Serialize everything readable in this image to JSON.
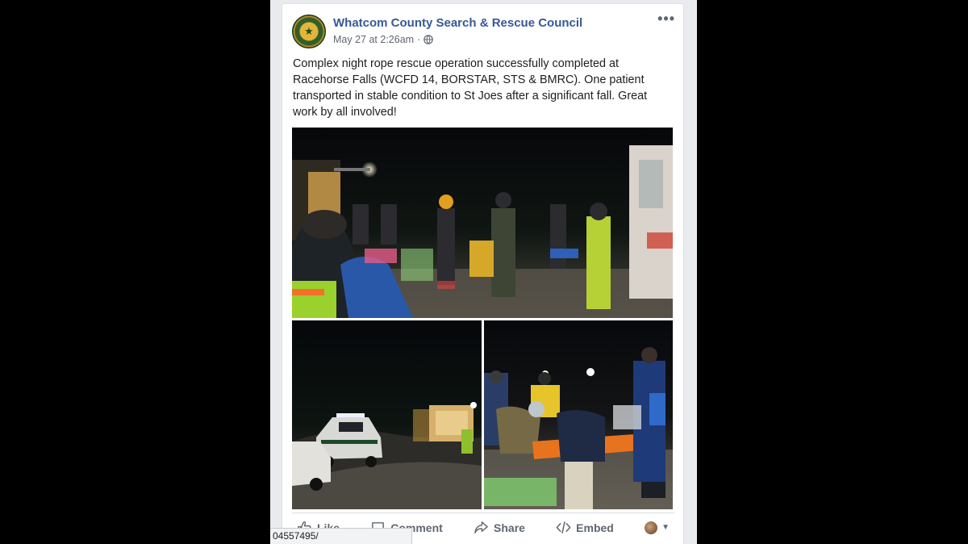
{
  "post": {
    "page_name": "Whatcom County Search & Rescue Council",
    "timestamp": "May 27 at 2:26am",
    "separator": "·",
    "privacy_icon": "globe-icon",
    "more_options_icon": "ellipsis-icon",
    "more_options_label": "•••",
    "body_text": "Complex night rope rescue operation successfully completed at Racehorse Falls (WCFD 14, BORSTAR, STS & BMRC). One patient transported in stable condition to St Joes after a significant fall. Great work by all involved!"
  },
  "photos": [
    {
      "label": "rescue-scene-main"
    },
    {
      "label": "patrol-vehicles-night"
    },
    {
      "label": "patient-on-stretcher"
    }
  ],
  "actions": {
    "like": "Like",
    "comment": "Comment",
    "share": "Share",
    "embed": "Embed"
  },
  "status_bar": {
    "url": "04557495/"
  },
  "colors": {
    "page_name": "#385898",
    "background": "#e9ebee",
    "action_text": "#606770"
  }
}
